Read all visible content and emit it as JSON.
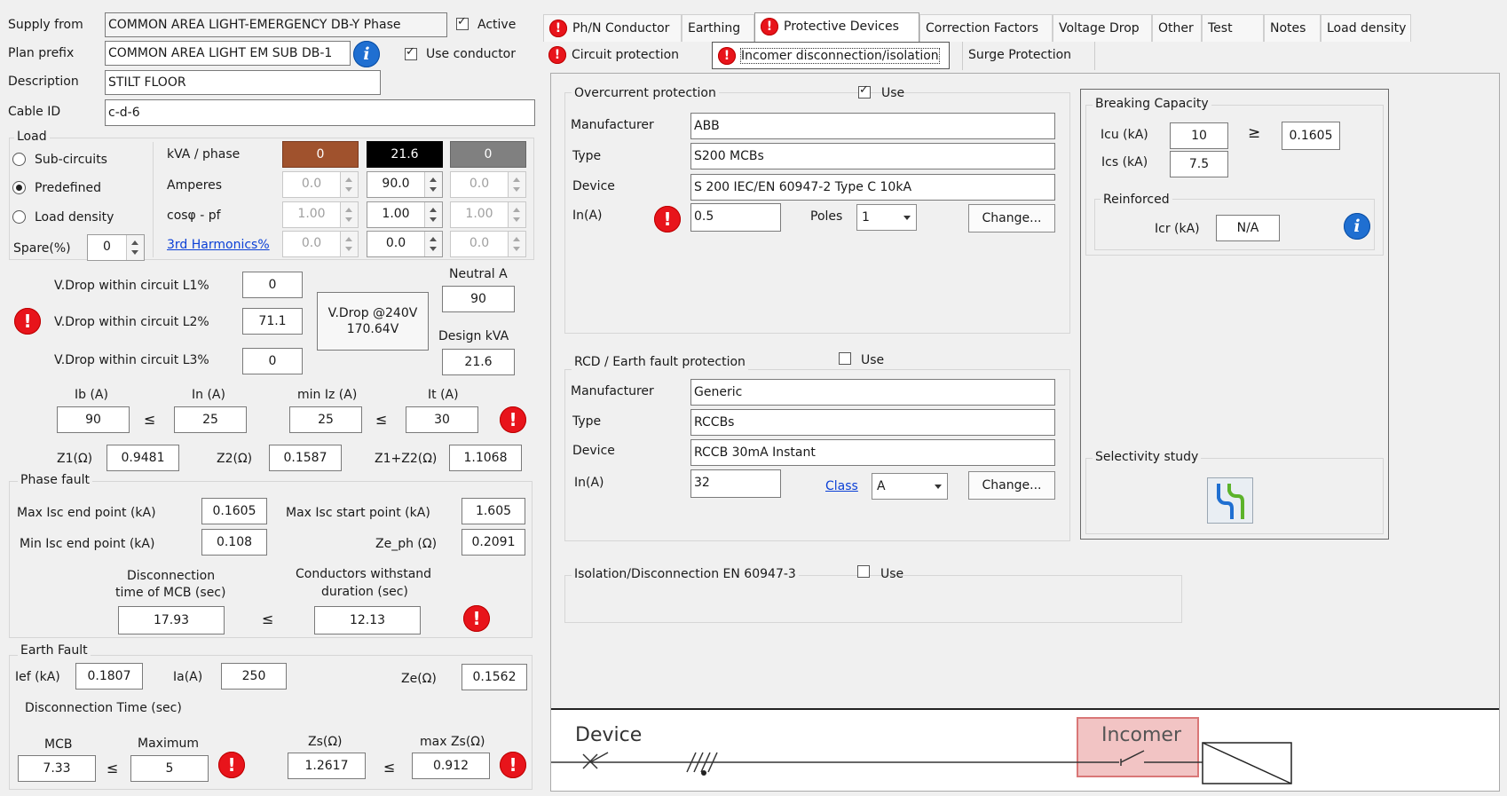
{
  "header": {
    "supply_from_label": "Supply from",
    "supply_from_value": "COMMON AREA LIGHT-EMERGENCY DB-Y Phase",
    "active_label": "Active",
    "plan_prefix_label": "Plan prefix",
    "plan_prefix_value": "COMMON AREA LIGHT EM SUB DB-1",
    "use_conductor_label": "Use conductor",
    "description_label": "Description",
    "description_value": "STILT FLOOR",
    "cable_id_label": "Cable ID",
    "cable_id_value": "c-d-6"
  },
  "load": {
    "title": "Load",
    "sub_circuits": "Sub-circuits",
    "predefined": "Predefined",
    "load_density": "Load density",
    "spare_label": "Spare(%)",
    "spare_value": "0",
    "kva_label": "kVA / phase",
    "kva": [
      "0",
      "21.6",
      "0"
    ],
    "amperes_label": "Amperes",
    "amperes": [
      "0.0",
      "90.0",
      "0.0"
    ],
    "pf_label": "cosφ - pf",
    "pf": [
      "1.00",
      "1.00",
      "1.00"
    ],
    "harm_label": "3rd Harmonics%",
    "harm": [
      "0.0",
      "0.0",
      "0.0"
    ],
    "phase_colors": [
      "#a0522d",
      "#000000",
      "#808080"
    ]
  },
  "vdrop": {
    "l1_label": "V.Drop within circuit L1%",
    "l1_value": "0",
    "l2_label": "V.Drop within circuit L2%",
    "l2_value": "71.1",
    "l3_label": "V.Drop within circuit L3%",
    "l3_value": "0",
    "box_line1": "V.Drop @240V",
    "box_line2": "170.64V",
    "neutral_label": "Neutral A",
    "neutral_value": "90",
    "design_label": "Design kVA",
    "design_value": "21.6"
  },
  "currents": {
    "ib_label": "Ib (A)",
    "ib_value": "90",
    "in_label": "In (A)",
    "in_value": "25",
    "miniz_label": "min Iz (A)",
    "miniz_value": "25",
    "it_label": "It (A)",
    "it_value": "30",
    "le": "≤"
  },
  "impedance": {
    "z1_label": "Z1(Ω)",
    "z1_value": "0.9481",
    "z2_label": "Z2(Ω)",
    "z2_value": "0.1587",
    "z12_label": "Z1+Z2(Ω)",
    "z12_value": "1.1068"
  },
  "phase_fault": {
    "title": "Phase fault",
    "max_end_label": "Max Isc end point (kA)",
    "max_end_value": "0.1605",
    "max_start_label": "Max Isc start point (kA)",
    "max_start_value": "1.605",
    "min_end_label": "Min Isc end point (kA)",
    "min_end_value": "0.108",
    "ze_ph_label": "Ze_ph (Ω)",
    "ze_ph_value": "0.2091",
    "disc_label_1": "Disconnection",
    "disc_label_2": "time of MCB (sec)",
    "disc_value": "17.93",
    "withstand_label_1": "Conductors withstand",
    "withstand_label_2": "duration (sec)",
    "withstand_value": "12.13"
  },
  "earth_fault": {
    "title": "Earth Fault",
    "ief_label": "Ief (kA)",
    "ief_value": "0.1807",
    "ia_label": "Ia(A)",
    "ia_value": "250",
    "ze_label": "Ze(Ω)",
    "ze_value": "0.1562",
    "disc_time_label": "Disconnection Time (sec)",
    "mcb_label": "MCB",
    "mcb_value": "7.33",
    "maximum_label": "Maximum",
    "maximum_value": "5",
    "zs_label": "Zs(Ω)",
    "zs_value": "1.2617",
    "maxzs_label": "max Zs(Ω)",
    "maxzs_value": "0.912"
  },
  "tabs": {
    "row1": [
      "Ph/N Conductor",
      "Earthing",
      "Protective Devices",
      "Correction Factors",
      "Voltage Drop",
      "Other",
      "Test",
      "Notes",
      "Load density"
    ],
    "row2": [
      "Circuit protection",
      "Incomer disconnection/isolation",
      "Surge Protection"
    ]
  },
  "overcurrent": {
    "title": "Overcurrent protection",
    "use_label": "Use",
    "manufacturer_label": "Manufacturer",
    "manufacturer_value": "ABB",
    "type_label": "Type",
    "type_value": "S200 MCBs",
    "device_label": "Device",
    "device_value": "S 200 IEC/EN 60947-2 Type C 10kA",
    "in_label": "In(A)",
    "in_value": "0.5",
    "poles_label": "Poles",
    "poles_value": "1",
    "change_label": "Change..."
  },
  "breaking": {
    "title": "Breaking Capacity",
    "icu_label": "Icu (kA)",
    "icu_value": "10",
    "ge": "≥",
    "ge_value": "0.1605",
    "ics_label": "Ics (kA)",
    "ics_value": "7.5",
    "reinforced_title": "Reinforced",
    "icr_label": "Icr (kA)",
    "icr_value": "N/A",
    "selectivity_title": "Selectivity study"
  },
  "rcd": {
    "title": "RCD / Earth fault protection",
    "use_label": "Use",
    "manufacturer_label": "Manufacturer",
    "manufacturer_value": "Generic",
    "type_label": "Type",
    "type_value": "RCCBs",
    "device_label": "Device",
    "device_value": "RCCB 30mA Instant",
    "in_label": "In(A)",
    "in_value": "32",
    "class_label": "Class",
    "class_value": "A",
    "change_label": "Change..."
  },
  "isolation": {
    "title": "Isolation/Disconnection EN 60947-3",
    "use_label": "Use"
  },
  "diagram": {
    "device_label": "Device",
    "incomer_label": "Incomer"
  }
}
